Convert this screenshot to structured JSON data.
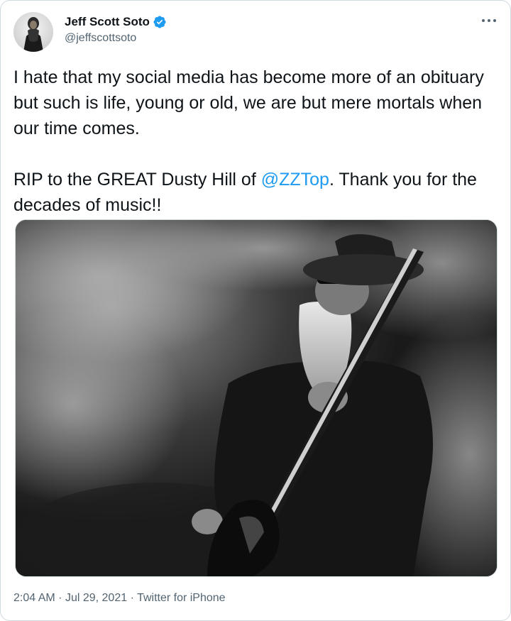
{
  "tweet": {
    "display_name": "Jeff Scott Soto",
    "handle": "@jeffscottsoto",
    "verified_icon": "verified-badge-icon",
    "more_icon": "more-options-icon",
    "text_part1": "I hate that my social media has become more of an obituary but such is life, young or old, we are but mere mortals when our time comes.\n\nRIP to the GREAT Dusty Hill of ",
    "mention": "@ZZTop",
    "text_part2": ". Thank you for the decades of music!!",
    "time": "2:04 AM",
    "date": "Jul 29, 2021",
    "source": "Twitter for iPhone",
    "separator": "·"
  },
  "colors": {
    "link": "#1d9bf0",
    "secondary_text": "#536471",
    "border": "#cfd9de",
    "verified": "#1d9bf0"
  }
}
